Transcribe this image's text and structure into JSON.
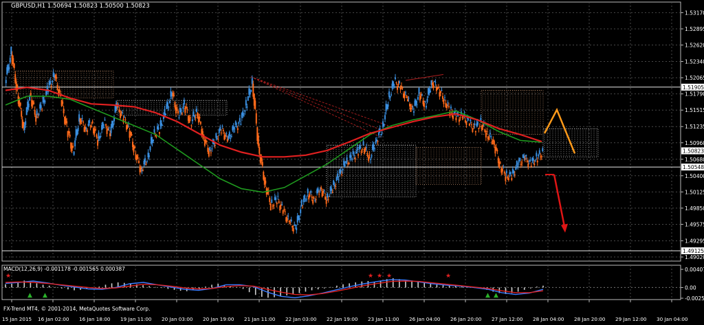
{
  "window": {
    "symbol_info": "GBPUSD,H1  1.50694 1.50823 1.50500 1.50823",
    "copyright": "FX-Trend MT4, © 2001-2014, MetaQuotes Software Corp."
  },
  "colors": {
    "background": "#000000",
    "grid": "#4a4a4a",
    "axis_text": "#ffffff",
    "candle_bull": "#3a8fe0",
    "candle_bear": "#ff6a1a",
    "ma_fast": "#1f9a1f",
    "ma_slow": "#e02020",
    "cloud_a": "#e6e6e6",
    "cloud_b": "#d9a27a",
    "projection_up": "#ff9a1a",
    "projection_down": "#e01515",
    "macd_histogram": "#d0d0d0",
    "macd_line": "#3b7bff",
    "signal_line": "#e02020",
    "price_label_box": "#ffffff"
  },
  "chart_data": [
    {
      "type": "candlestick",
      "title": "GBPUSD,H1",
      "ohlc_header": {
        "open": 1.50694,
        "high": 1.50823,
        "low": 1.505,
        "close": 1.50823
      },
      "ylim": [
        1.4895,
        1.5335
      ],
      "y_ticks": [
        "1.53170",
        "1.52895",
        "1.52620",
        "1.52340",
        "1.52065",
        "1.51790",
        "1.51515",
        "1.51235",
        "1.50960",
        "1.50680",
        "1.50400",
        "1.50125",
        "1.49850",
        "1.49575",
        "1.49295",
        "1.49020"
      ],
      "x_ticks": [
        "15 Jan 2015",
        "16 Jan 02:00",
        "16 Jan 18:00",
        "19 Jan 11:00",
        "20 Jan 03:00",
        "20 Jan 19:00",
        "21 Jan 11:00",
        "22 Jan 03:00",
        "22 Jan 19:00",
        "23 Jan 11:00",
        "26 Jan 04:00",
        "26 Jan 20:00",
        "27 Jan 12:00",
        "28 Jan 04:00",
        "28 Jan 20:00",
        "29 Jan 12:00",
        "30 Jan 04:00"
      ],
      "price_labels": [
        {
          "text": "1.51905",
          "value": 1.51905
        },
        {
          "text": "1.50823",
          "value": 1.50823
        },
        {
          "text": "1.50548",
          "value": 1.50548
        },
        {
          "text": "1.49125",
          "value": 1.49125
        }
      ],
      "horizontal_lines": [
        1.51905,
        1.50548,
        1.49125
      ],
      "close_path": [
        1.52,
        1.525,
        1.518,
        1.512,
        1.518,
        1.514,
        1.516,
        1.519,
        1.521,
        1.517,
        1.512,
        1.508,
        1.514,
        1.512,
        1.513,
        1.51,
        1.513,
        1.511,
        1.516,
        1.514,
        1.512,
        1.508,
        1.505,
        1.507,
        1.511,
        1.512,
        1.515,
        1.518,
        1.514,
        1.516,
        1.513,
        1.515,
        1.511,
        1.508,
        1.51,
        1.512,
        1.51,
        1.512,
        1.513,
        1.516,
        1.52,
        1.509,
        1.503,
        1.499,
        1.5,
        1.498,
        1.496,
        1.495,
        1.499,
        1.501,
        1.5,
        1.502,
        1.5,
        1.502,
        1.504,
        1.506,
        1.507,
        1.508,
        1.509,
        1.507,
        1.51,
        1.512,
        1.517,
        1.52,
        1.519,
        1.517,
        1.515,
        1.518,
        1.516,
        1.52,
        1.519,
        1.517,
        1.515,
        1.514,
        1.514,
        1.513,
        1.512,
        1.513,
        1.511,
        1.51,
        1.506,
        1.504,
        1.504,
        1.506,
        1.507,
        1.506,
        1.507,
        1.508
      ],
      "ma_fast": [
        1.516,
        1.5175,
        1.5175,
        1.517,
        1.5155,
        1.514,
        1.5125,
        1.511,
        1.5085,
        1.506,
        1.5035,
        1.5018,
        1.5012,
        1.502,
        1.504,
        1.506,
        1.5085,
        1.511,
        1.5125,
        1.5135,
        1.5142,
        1.515,
        1.5135,
        1.5115,
        1.51,
        1.5097
      ],
      "ma_slow": [
        1.5185,
        1.519,
        1.5185,
        1.5172,
        1.5162,
        1.516,
        1.5157,
        1.5147,
        1.5132,
        1.5112,
        1.5092,
        1.508,
        1.5072,
        1.5072,
        1.5075,
        1.5083,
        1.5097,
        1.5112,
        1.5122,
        1.5132,
        1.514,
        1.5145,
        1.5135,
        1.512,
        1.511,
        1.5098
      ],
      "forecast": {
        "zigzag": [
          1.5112,
          1.5152,
          1.5078
        ],
        "down_arrow": [
          1.5042,
          1.4948
        ]
      }
    },
    {
      "type": "bar",
      "title": "MACD(12,26,9)",
      "legend": "MACD(12,26,9) -0.001178 -0.001565 0.000387",
      "values_header": {
        "main": -0.001178,
        "signal": -0.001565,
        "histogram": 0.000387
      },
      "ylim": [
        -0.0026,
        0.0048
      ],
      "y_ticks": [
        "0.004074",
        "0.00",
        "-0.002510"
      ],
      "histogram": [
        0.0007,
        0.0008,
        0.0012,
        0.0015,
        0.0011,
        0.0009,
        0.0006,
        0.0004,
        0.0001,
        -0.0002,
        -0.0004,
        -0.0006,
        -0.0005,
        -0.0003,
        -0.0001,
        0.0002,
        0.0006,
        0.0009,
        0.0011,
        0.001,
        0.0008,
        0.0007,
        0.0005,
        0.0003,
        0.0001,
        -0.0001,
        -0.0003,
        -0.0005,
        -0.0007,
        -0.0008,
        -0.0006,
        -0.0004,
        0.0002,
        0.0006,
        0.0008,
        0.0005,
        0.0003,
        0.0001,
        -0.0003,
        -0.001,
        -0.0016,
        -0.002,
        -0.0022,
        -0.0021,
        -0.0019,
        -0.0017,
        -0.0015,
        -0.0012,
        -0.0009,
        -0.0006,
        -0.0004,
        -0.0002,
        0.0001,
        0.0004,
        0.0007,
        0.0009,
        0.0011,
        0.0013,
        0.0014,
        0.0012,
        0.0015,
        0.0018,
        0.002,
        0.0018,
        0.0016,
        0.0015,
        0.0012,
        0.001,
        0.0008,
        0.0006,
        0.0005,
        0.0004,
        0.0003,
        0.0002,
        0.0001,
        -0.0001,
        -0.0002,
        -0.0005,
        -0.0009,
        -0.0012,
        -0.0014,
        -0.0012,
        -0.0009,
        -0.0005,
        -0.0002,
        0.0002,
        0.0004
      ],
      "macd_line": [
        0.0009,
        0.0011,
        0.0014,
        0.001,
        0.0005,
        0.0001,
        -0.0003,
        -0.0004,
        0.0,
        0.0008,
        0.0011,
        0.0006,
        0.0001,
        -0.0004,
        -0.0006,
        -0.0002,
        0.0006,
        0.0006,
        0.0002,
        -0.001,
        -0.0019,
        -0.0022,
        -0.0018,
        -0.0012,
        -0.0005,
        0.0002,
        0.0008,
        0.0013,
        0.0017,
        0.0016,
        0.0012,
        0.0008,
        0.0005,
        0.0003,
        0.0,
        -0.0004,
        -0.0011,
        -0.0015,
        -0.0012,
        -0.0004
      ],
      "signal_line": [
        0.0011,
        0.0012,
        0.0011,
        0.0009,
        0.0006,
        0.0003,
        0.0,
        -0.0002,
        -0.0001,
        0.0003,
        0.0007,
        0.0006,
        0.0003,
        -0.0001,
        -0.0003,
        -0.0002,
        0.0002,
        0.0004,
        0.0003,
        -0.0004,
        -0.001,
        -0.0015,
        -0.0016,
        -0.0013,
        -0.0008,
        -0.0002,
        0.0004,
        0.0009,
        0.0013,
        0.0014,
        0.0013,
        0.001,
        0.0007,
        0.0004,
        0.0001,
        -0.0002,
        -0.0007,
        -0.0011,
        -0.0011,
        -0.0007
      ]
    }
  ]
}
